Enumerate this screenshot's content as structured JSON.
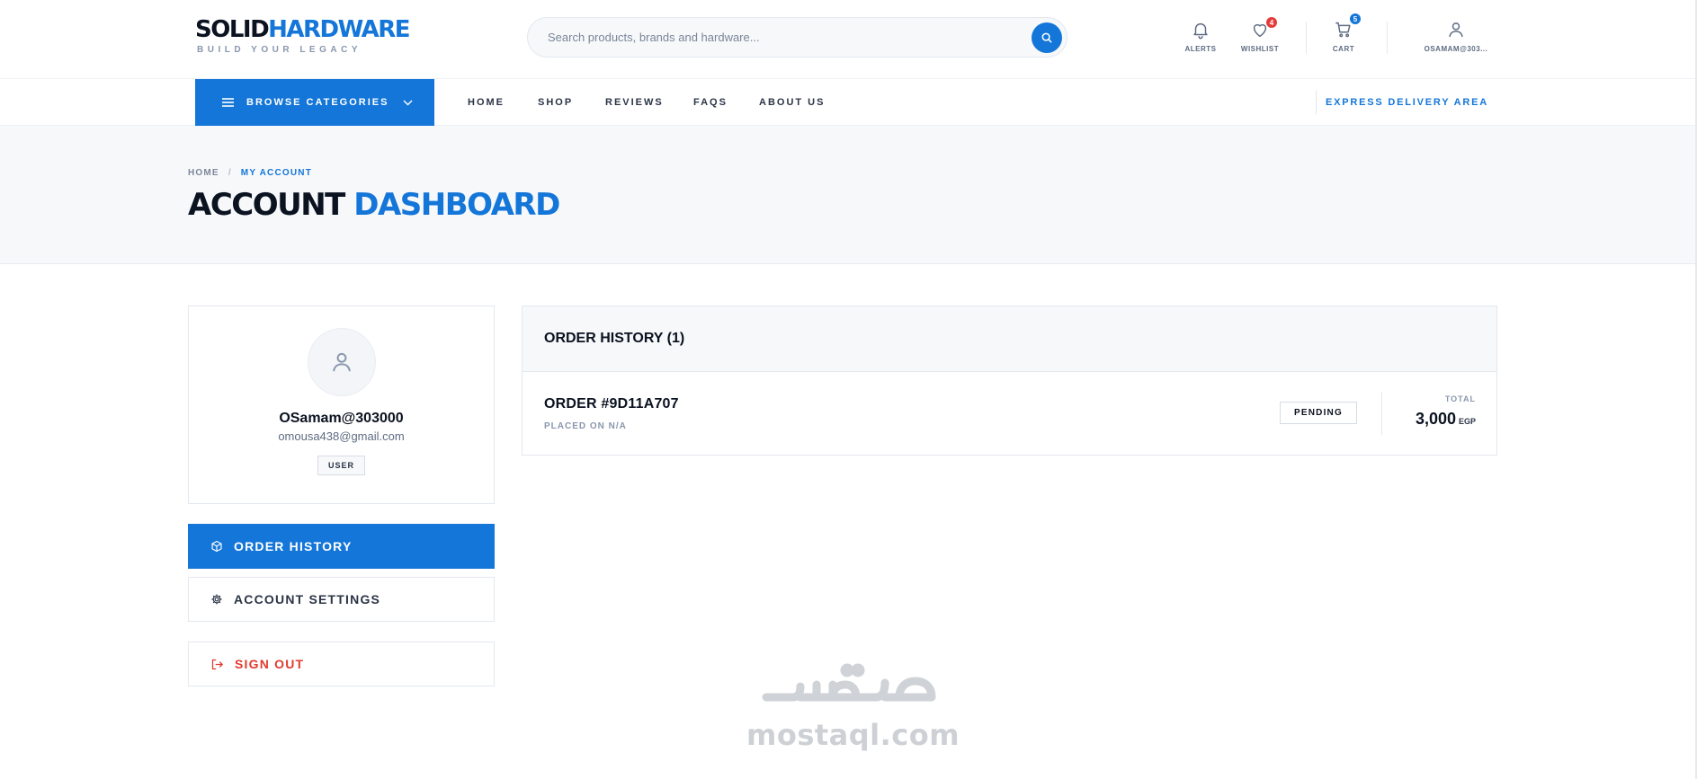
{
  "brand": {
    "name_dark": "SOLID",
    "name_blue": "HARDWARE",
    "tagline": "BUILD YOUR LEGACY"
  },
  "search": {
    "placeholder": "Search products, brands and hardware..."
  },
  "header_icons": {
    "alerts": {
      "label": "ALERTS",
      "icon": "bell-icon"
    },
    "wishlist": {
      "label": "WISHLIST",
      "icon": "heart-icon",
      "count": "4",
      "badge_color": "#e53b3b"
    },
    "cart": {
      "label": "CART",
      "icon": "cart-icon",
      "count": "5",
      "badge_color": "#1476d8"
    },
    "account": {
      "label": "OSAMAM@303...",
      "icon": "user-icon"
    }
  },
  "nav": {
    "browse_label": "BROWSE CATEGORIES",
    "links": [
      "HOME",
      "SHOP",
      "REVIEWS",
      "FAQS",
      "ABOUT US"
    ],
    "express": "EXPRESS DELIVERY AREA"
  },
  "breadcrumb": {
    "home": "HOME",
    "separator": "/",
    "current": "MY ACCOUNT"
  },
  "page_title": {
    "dark": "ACCOUNT",
    "blue": "DASHBOARD"
  },
  "profile": {
    "name": "OSamam@303000",
    "email": "omousa438@gmail.com",
    "role": "USER"
  },
  "menu": {
    "order_history": "ORDER HISTORY",
    "account_settings": "ACCOUNT SETTINGS",
    "sign_out": "SIGN OUT"
  },
  "orders": {
    "title": "ORDER HISTORY (1)",
    "items": [
      {
        "id": "ORDER #9D11A707",
        "placed": "PLACED ON N/A",
        "status": "PENDING",
        "total_label": "TOTAL",
        "total": "3,000",
        "currency": "EGP"
      }
    ]
  },
  "watermark": {
    "text": "mostaql.com",
    "arabic": "مستقل"
  },
  "colors": {
    "accent": "#1476d8",
    "danger": "#e03b2e",
    "dark": "#0b1220"
  }
}
